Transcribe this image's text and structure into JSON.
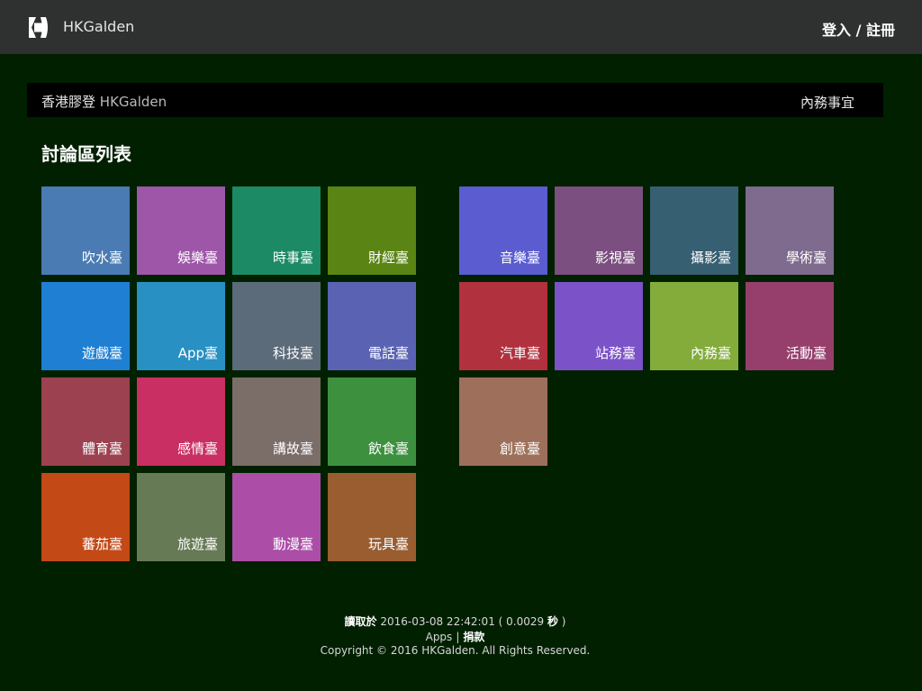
{
  "header": {
    "brand": "HKGalden",
    "auth_link": "登入 / 註冊"
  },
  "subbar": {
    "site_name_zh": "香港膠登",
    "site_name_en": "HKGalden",
    "right_link": "內務事宜"
  },
  "main": {
    "heading": "討論區列表",
    "boards": [
      {
        "label": "吹水臺",
        "color": "#4a7bb2"
      },
      {
        "label": "娛樂臺",
        "color": "#9e56a8"
      },
      {
        "label": "時事臺",
        "color": "#1d8a66"
      },
      {
        "label": "財經臺",
        "color": "#5a8514"
      },
      {
        "label": "遊戲臺",
        "color": "#1f7fd3"
      },
      {
        "label": "App臺",
        "color": "#2890c3"
      },
      {
        "label": "科技臺",
        "color": "#5c6b7a"
      },
      {
        "label": "電話臺",
        "color": "#5a63b3"
      },
      {
        "label": "體育臺",
        "color": "#9c4150"
      },
      {
        "label": "感情臺",
        "color": "#c92f62"
      },
      {
        "label": "講故臺",
        "color": "#7b6d68"
      },
      {
        "label": "飲食臺",
        "color": "#3d913e"
      },
      {
        "label": "蕃茄臺",
        "color": "#c34917"
      },
      {
        "label": "旅遊臺",
        "color": "#667a55"
      },
      {
        "label": "動漫臺",
        "color": "#ac4ea8"
      },
      {
        "label": "玩具臺",
        "color": "#9a5d2f"
      },
      {
        "label": "音樂臺",
        "color": "#5a5ccf"
      },
      {
        "label": "影視臺",
        "color": "#7b4f7f"
      },
      {
        "label": "攝影臺",
        "color": "#365f72"
      },
      {
        "label": "學術臺",
        "color": "#7e6b8e"
      },
      {
        "label": "汽車臺",
        "color": "#b2313e"
      },
      {
        "label": "站務臺",
        "color": "#7c52c8"
      },
      {
        "label": "內務臺",
        "color": "#83ac3a"
      },
      {
        "label": "活動臺",
        "color": "#963f6c"
      },
      {
        "label": "創意臺",
        "color": "#9e705b"
      }
    ]
  },
  "footer": {
    "read_label": "讀取於",
    "timestamp": "2016-03-08 22:42:01 ( 0.0029",
    "seconds_label": "秒",
    "close_paren": " )",
    "apps_link": "Apps",
    "divider": "|",
    "donate_link": "捐款",
    "copyright": "Copyright © 2016 HKGalden. All Rights Reserved."
  }
}
